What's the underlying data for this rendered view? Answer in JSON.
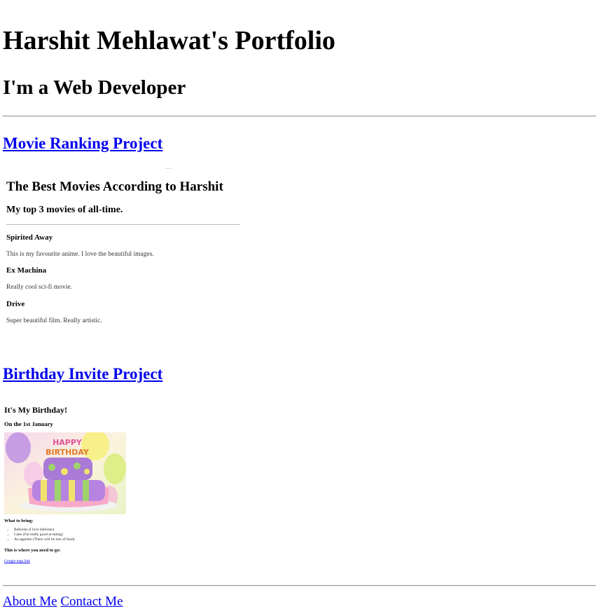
{
  "header": {
    "title": "Harshit Mehlawat's Portfolio",
    "subtitle": "I'm a Web Developer"
  },
  "projects": {
    "movie": {
      "link_label": "Movie Ranking Project",
      "preview": {
        "title": "The Best Movies According to Harshit",
        "subtitle": "My top 3 movies of all-time.",
        "movies": [
          {
            "name": "Spirited Away",
            "desc": "This is my favourite anime. I love the beautiful images."
          },
          {
            "name": "Ex Machina",
            "desc": "Really cool sci-fi movie."
          },
          {
            "name": "Drive",
            "desc": "Super beautiful film. Really artistic."
          }
        ]
      }
    },
    "birthday": {
      "link_label": "Birthday Invite Project",
      "preview": {
        "title": "It's My Birthday!",
        "date": "On the 1st January",
        "image_text": "HAPPY BIRTHDAY",
        "bring_heading": "What to bring:",
        "items": [
          "Balloons (I love balloons)",
          "Cake (I'm really good at eating)",
          "An appetite (There will be lots of food)"
        ],
        "where_heading": "This is where you need to go:",
        "map_link": "Google map link"
      }
    }
  },
  "footer": {
    "about": "About Me",
    "contact": "Contact Me"
  },
  "colors": {
    "link": "#0000ee",
    "rule": "#9a9a9a"
  }
}
